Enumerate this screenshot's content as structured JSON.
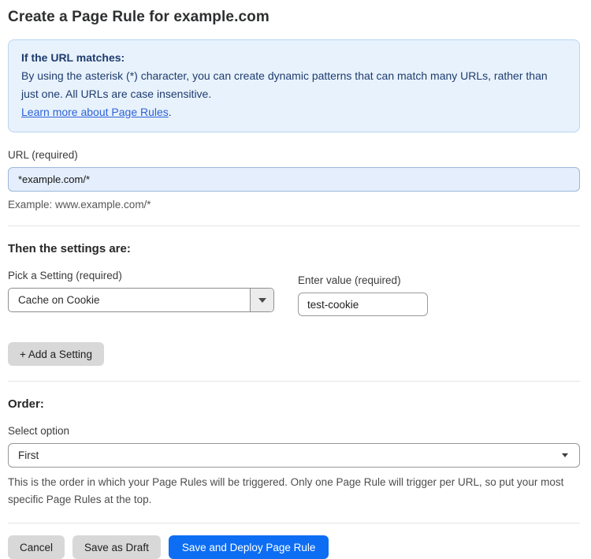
{
  "page": {
    "title": "Create a Page Rule for example.com"
  },
  "info_box": {
    "heading": "If the URL matches:",
    "body": "By using the asterisk (*) character, you can create dynamic patterns that can match many URLs, rather than just one. All URLs are case insensitive.",
    "link_label": "Learn more about Page Rules",
    "link_suffix": "."
  },
  "url_field": {
    "label": "URL (required)",
    "value": "*example.com/*",
    "example": "Example: www.example.com/*"
  },
  "settings_section": {
    "heading": "Then the settings are:",
    "setting_select": {
      "label": "Pick a Setting (required)",
      "selected_value": "Cache on Cookie"
    },
    "value_field": {
      "label": "Enter value (required)",
      "value": "test-cookie"
    },
    "add_setting_label": "+ Add a Setting"
  },
  "order_section": {
    "heading": "Order:",
    "select_label": "Select option",
    "selected_option": "First",
    "help_text": "This is the order in which your Page Rules will be triggered. Only one Page Rule will trigger per URL, so put your most specific Page Rules at the top."
  },
  "footer": {
    "cancel_label": "Cancel",
    "save_draft_label": "Save as Draft",
    "save_deploy_label": "Save and Deploy Page Rule"
  },
  "colors": {
    "info_bg": "#e8f2fc",
    "info_border": "#b8d4f1",
    "info_text": "#1e3c6e",
    "link": "#2c62d9",
    "url_input_bg": "#e4eefc",
    "url_input_border": "#9db7da",
    "primary_button": "#0d6ef4",
    "gray_button": "#d8d8d8"
  }
}
